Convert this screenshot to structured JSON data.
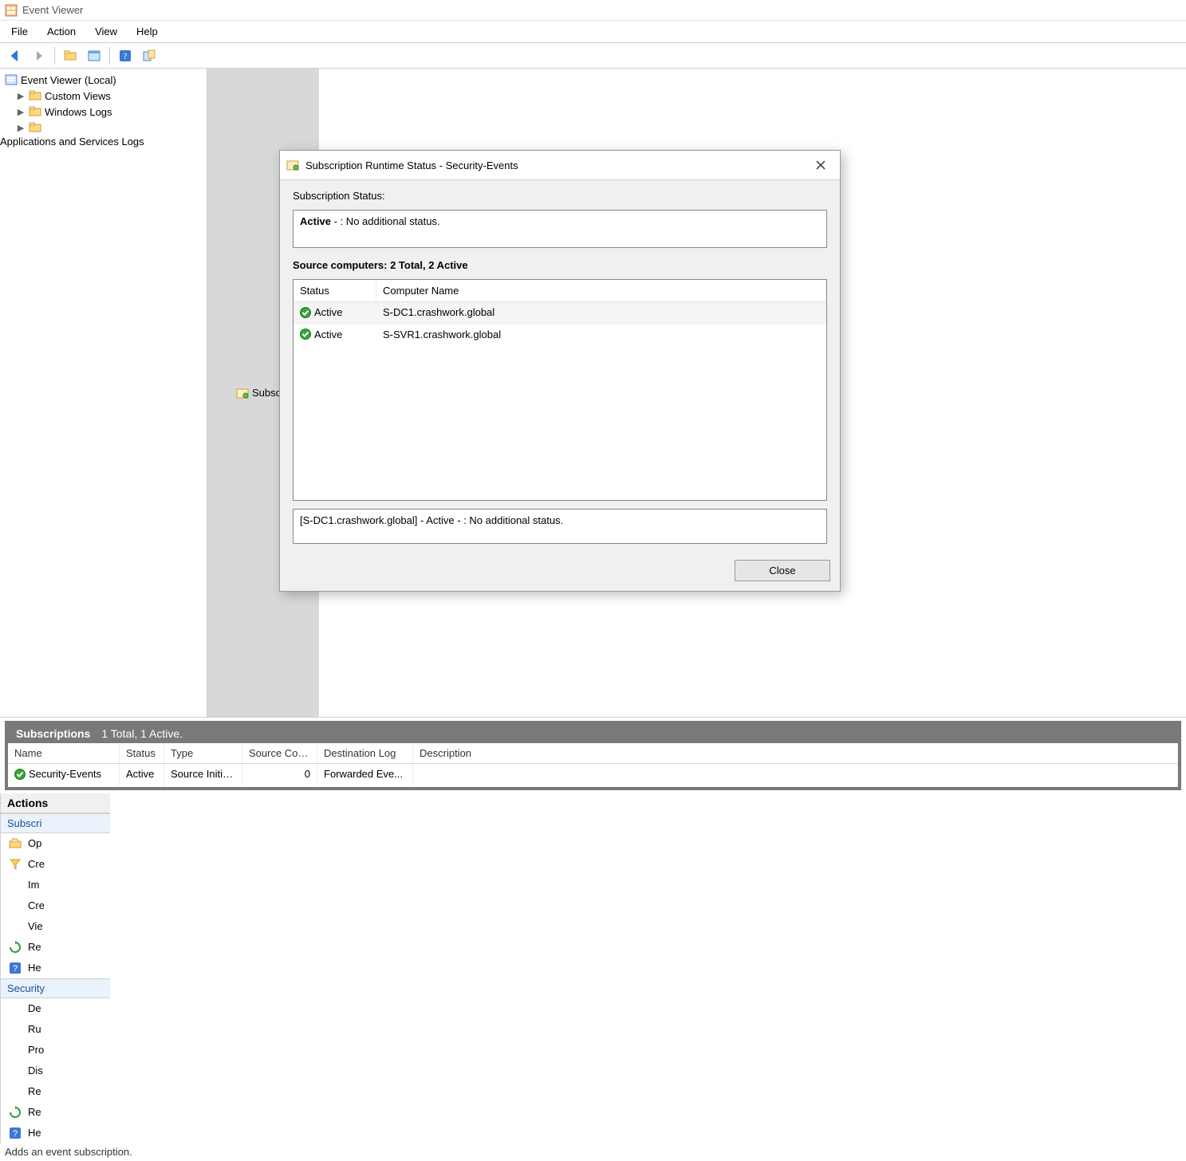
{
  "titlebar": {
    "title": "Event Viewer"
  },
  "menubar": [
    "File",
    "Action",
    "View",
    "Help"
  ],
  "tree": {
    "root": "Event Viewer (Local)",
    "items": [
      {
        "label": "Custom Views",
        "expandable": true
      },
      {
        "label": "Windows Logs",
        "expandable": true
      },
      {
        "label": "Applications and Services Logs",
        "expandable": true
      },
      {
        "label": "Subscriptions",
        "expandable": false,
        "selected": true
      }
    ]
  },
  "main": {
    "header_title": "Subscriptions",
    "header_sub": "1 Total, 1 Active.",
    "columns": [
      "Name",
      "Status",
      "Type",
      "Source Com...",
      "Destination Log",
      "Description"
    ],
    "rows": [
      {
        "name": "Security-Events",
        "status": "Active",
        "type": "Source Initia...",
        "source_count": "0",
        "dest": "Forwarded Eve...",
        "desc": ""
      }
    ]
  },
  "actions": {
    "pane_title": "Actions",
    "group1_title": "Subscri",
    "group1": [
      {
        "icon": "folder-open-icon",
        "label": "Op"
      },
      {
        "icon": "funnel-icon",
        "label": "Cre"
      },
      {
        "icon": "blank-icon",
        "label": "Im"
      },
      {
        "icon": "blank-icon",
        "label": "Cre"
      },
      {
        "icon": "blank-icon",
        "label": "Vie"
      },
      {
        "icon": "refresh-icon",
        "label": "Re"
      },
      {
        "icon": "help-icon",
        "label": "He"
      }
    ],
    "group2_title": "Security",
    "group2": [
      {
        "icon": "blank-icon",
        "label": "De"
      },
      {
        "icon": "blank-icon",
        "label": "Ru"
      },
      {
        "icon": "blank-icon",
        "label": "Pro"
      },
      {
        "icon": "blank-icon",
        "label": "Dis"
      },
      {
        "icon": "blank-icon",
        "label": "Re"
      },
      {
        "icon": "refresh-icon",
        "label": "Re"
      },
      {
        "icon": "help-icon",
        "label": "He"
      }
    ]
  },
  "dialog": {
    "title": "Subscription Runtime Status - Security-Events",
    "status_label": "Subscription Status:",
    "status_strong": "Active",
    "status_rest": " - : No additional status.",
    "src_label": "Source computers: 2 Total, 2 Active",
    "src_columns": [
      "Status",
      "Computer Name"
    ],
    "src_rows": [
      {
        "status": "Active",
        "name": "S-DC1.crashwork.global"
      },
      {
        "status": "Active",
        "name": "S-SVR1.crashwork.global"
      }
    ],
    "detail_pre": "[S-DC1.crashwork.global] - ",
    "detail_strong": "Active",
    "detail_post": " - : No additional status.",
    "close": "Close"
  },
  "statusbar": "Adds an event subscription."
}
